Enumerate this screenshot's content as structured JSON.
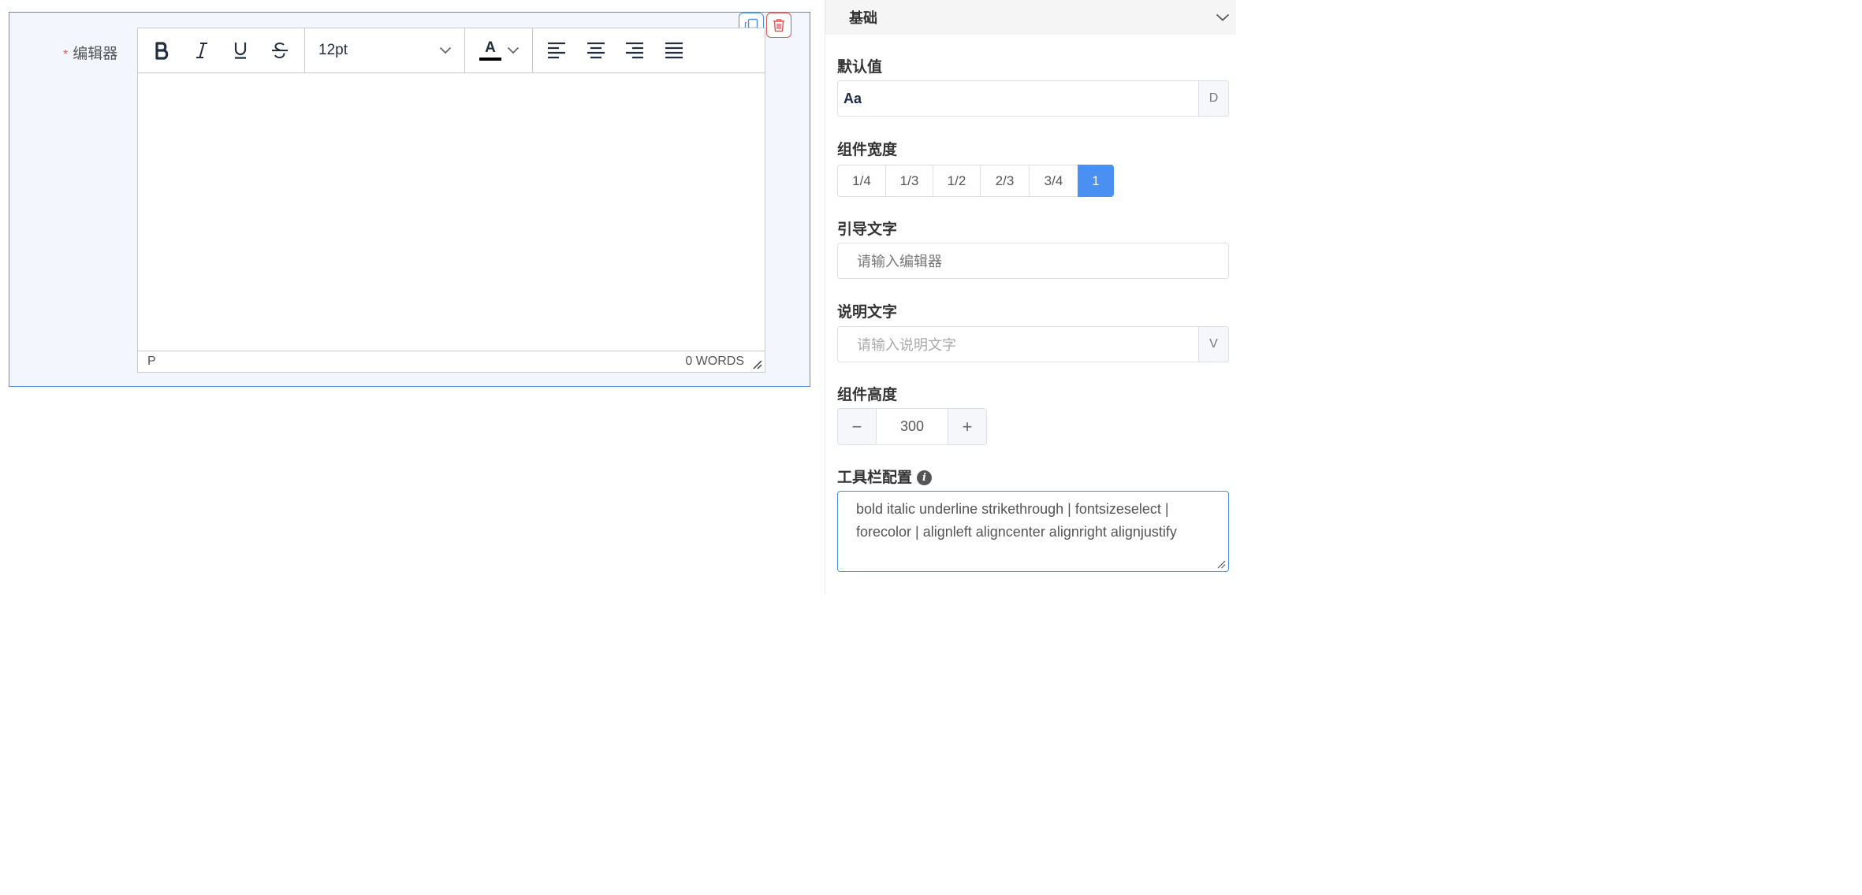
{
  "canvas": {
    "field_required_mark": "*",
    "field_label": "编辑器",
    "actions": {
      "copy_icon": "copy-icon",
      "delete_icon": "trash-icon"
    },
    "editor": {
      "toolbar": {
        "bold": "bold-icon",
        "italic": "italic-icon",
        "underline": "underline-icon",
        "strikethrough": "strikethrough-icon",
        "font_size": "12pt",
        "fore_color_glyph": "A",
        "align": [
          "align-left-icon",
          "align-center-icon",
          "align-right-icon",
          "align-justify-icon"
        ]
      },
      "status_path": "P",
      "word_count": "0 WORDS"
    }
  },
  "panel": {
    "section_title": "基础",
    "default_value": {
      "label": "默认值",
      "value": "Aa",
      "addon": "D"
    },
    "width": {
      "label": "组件宽度",
      "options": [
        "1/4",
        "1/3",
        "1/2",
        "2/3",
        "3/4",
        "1"
      ],
      "selected": "1"
    },
    "placeholder": {
      "label": "引导文字",
      "value": "请输入编辑器"
    },
    "description": {
      "label": "说明文字",
      "placeholder": "请输入说明文字",
      "addon": "V"
    },
    "height": {
      "label": "组件高度",
      "value": "300",
      "minus": "−",
      "plus": "+"
    },
    "toolbar_config": {
      "label": "工具栏配置",
      "value": "bold italic underline strikethrough | fontsizeselect | forecolor | alignleft aligncenter alignright alignjustify"
    }
  },
  "colors": {
    "accent": "#4a90e2",
    "danger": "#e05555",
    "active_segment": "#4a90f2",
    "component_bg": "#f4f6fe"
  }
}
